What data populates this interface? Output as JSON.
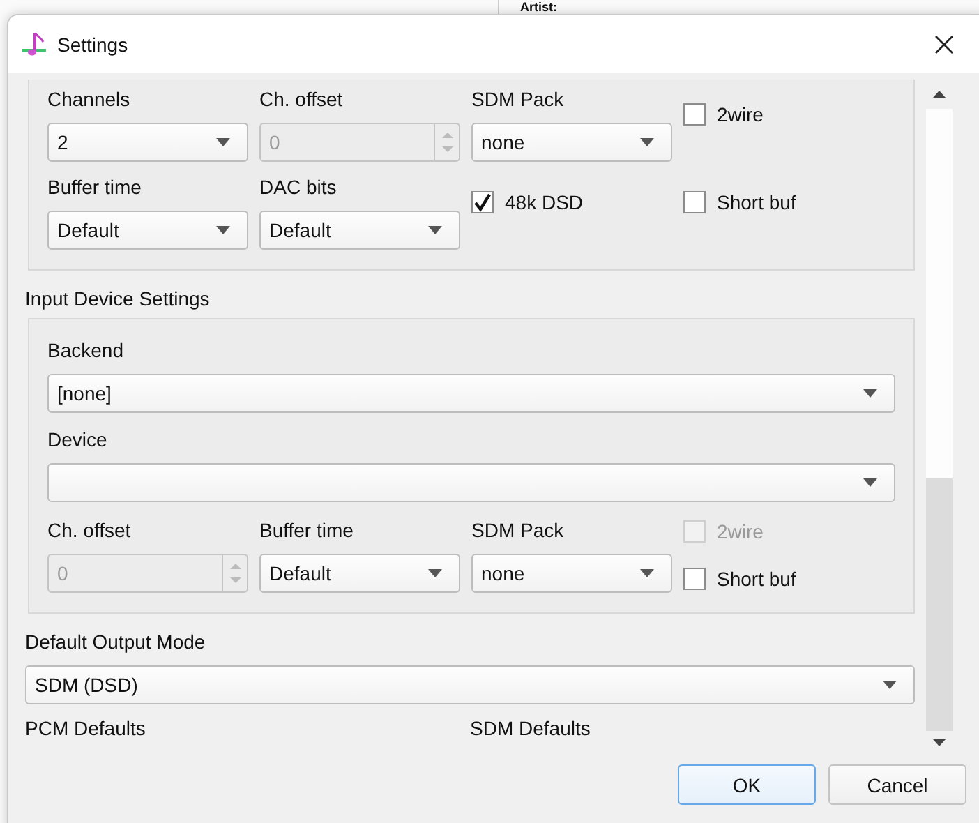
{
  "background": {
    "label": "Artist:"
  },
  "window": {
    "title": "Settings"
  },
  "output_device": {
    "fields": [
      {
        "kind": "combo",
        "label": "Channels",
        "value": "2"
      },
      {
        "kind": "spin",
        "label": "Ch. offset",
        "value": "0",
        "disabled": true
      },
      {
        "kind": "combo",
        "label": "SDM Pack",
        "value": "none"
      },
      {
        "kind": "checkbox",
        "label": "2wire",
        "checked": false,
        "disabled": false
      },
      {
        "kind": "combo",
        "label": "Buffer time",
        "value": "Default"
      },
      {
        "kind": "combo",
        "label": "DAC bits",
        "value": "Default"
      },
      {
        "kind": "checkbox",
        "label": "48k DSD",
        "checked": true,
        "disabled": false
      },
      {
        "kind": "checkbox",
        "label": "Short buf",
        "checked": false,
        "disabled": false
      }
    ]
  },
  "input_device": {
    "title": "Input Device Settings",
    "backend": {
      "label": "Backend",
      "value": "[none]"
    },
    "device": {
      "label": "Device"
    },
    "fields": [
      {
        "kind": "spin",
        "label": "Ch. offset",
        "value": "0",
        "disabled": true
      },
      {
        "kind": "combo",
        "label": "Buffer time",
        "value": "Default"
      },
      {
        "kind": "combo",
        "label": "SDM Pack",
        "value": "none"
      }
    ],
    "checkboxes": [
      {
        "label": "2wire",
        "checked": false,
        "disabled": true
      },
      {
        "label": "Short buf",
        "checked": false,
        "disabled": false
      }
    ]
  },
  "default_output_mode": {
    "label": "Default Output Mode",
    "value": "SDM (DSD)"
  },
  "sections": [
    "PCM Defaults",
    "SDM Defaults"
  ],
  "buttons": [
    {
      "label": "OK",
      "default": true
    },
    {
      "label": "Cancel",
      "default": false
    }
  ]
}
